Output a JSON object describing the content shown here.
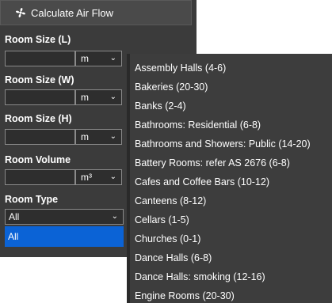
{
  "calculate_button": {
    "label": "Calculate Air Flow",
    "icon": "fan-icon"
  },
  "fields": [
    {
      "label": "Room Size (L)",
      "value": "",
      "unit": "m"
    },
    {
      "label": "Room Size (W)",
      "value": "",
      "unit": "m"
    },
    {
      "label": "Room Size (H)",
      "value": "",
      "unit": "m"
    },
    {
      "label": "Room Volume",
      "value": "",
      "unit": "m³"
    }
  ],
  "room_type": {
    "label": "Room Type",
    "selected": "All",
    "highlighted_option": "All"
  },
  "dropdown_options": [
    "Assembly Halls (4-6)",
    "Bakeries (20-30)",
    "Banks (2-4)",
    "Bathrooms: Residential (6-8)",
    "Bathrooms and Showers: Public (14-20)",
    "Battery Rooms: refer AS 2676 (6-8)",
    "Cafes and Coffee Bars (10-12)",
    "Canteens (8-12)",
    "Cellars (1-5)",
    "Churches (0-1)",
    "Dance Halls (6-8)",
    "Dance Halls: smoking (12-16)",
    "Engine Rooms (20-30)"
  ],
  "chevron": "⌄",
  "colors": {
    "panel_bg": "#3b3b3b",
    "selected_bg": "#0b63d6",
    "dropdown_bg": "#3d3d3d"
  }
}
